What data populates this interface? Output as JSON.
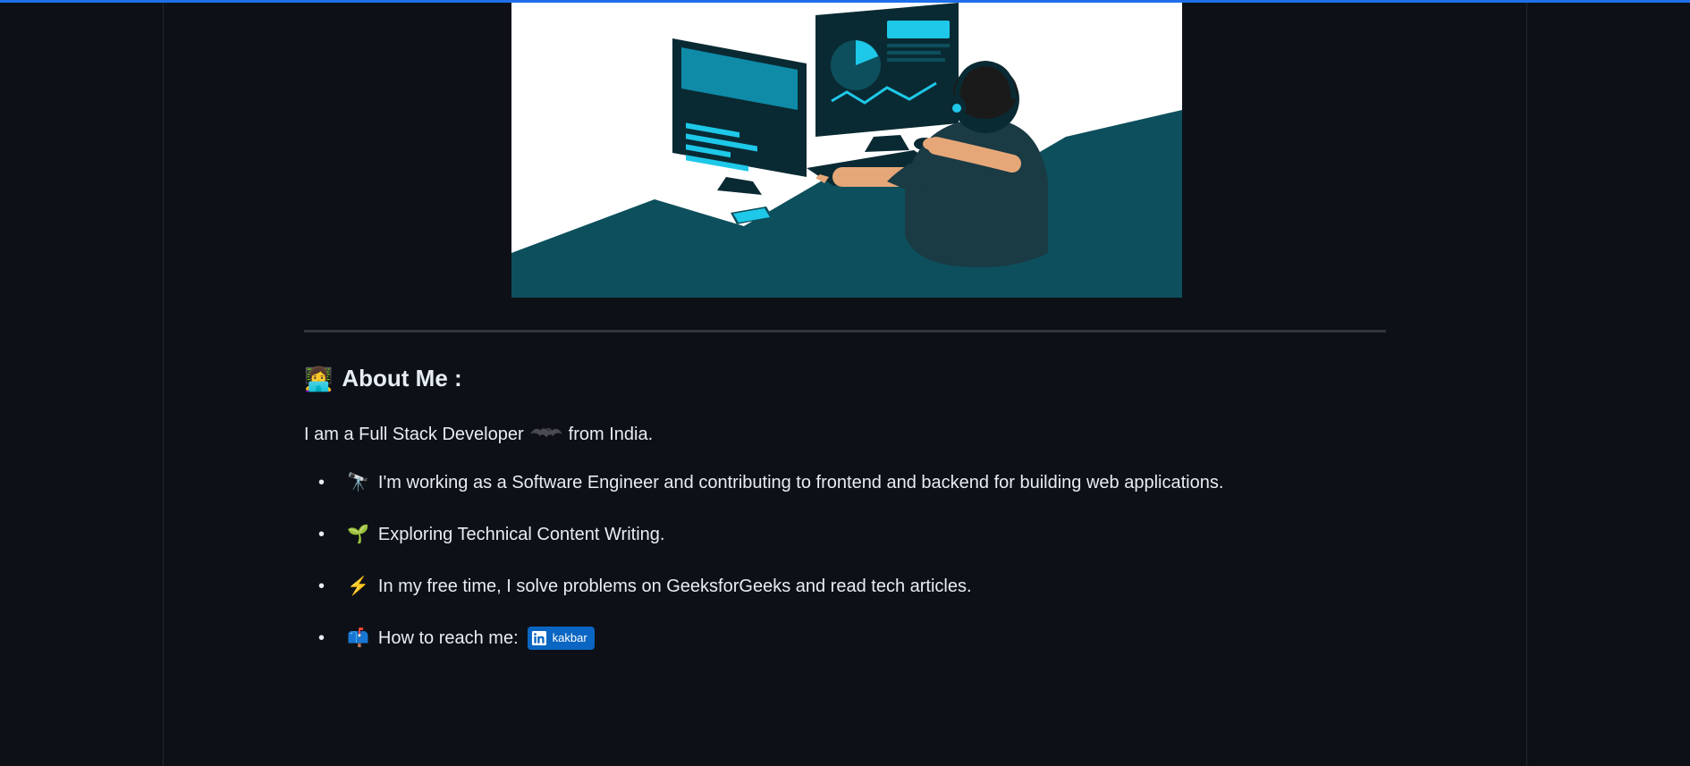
{
  "aboutMe": {
    "heading_emoji": "👩‍💻",
    "heading": "About Me :",
    "intro_prefix": "I am a Full Stack Developer",
    "intro_suffix": "from India.",
    "bullets": [
      {
        "emoji": "🔭",
        "text": "I'm working as a Software Engineer and contributing to frontend and backend for building web applications."
      },
      {
        "emoji": "🌱",
        "text": "Exploring Technical Content Writing."
      },
      {
        "emoji": "⚡",
        "text": "In my free time, I solve problems on GeeksforGeeks and read tech articles."
      }
    ],
    "reach": {
      "emoji": "📫",
      "label": "How to reach me:",
      "badge_text": "kakbar"
    }
  }
}
